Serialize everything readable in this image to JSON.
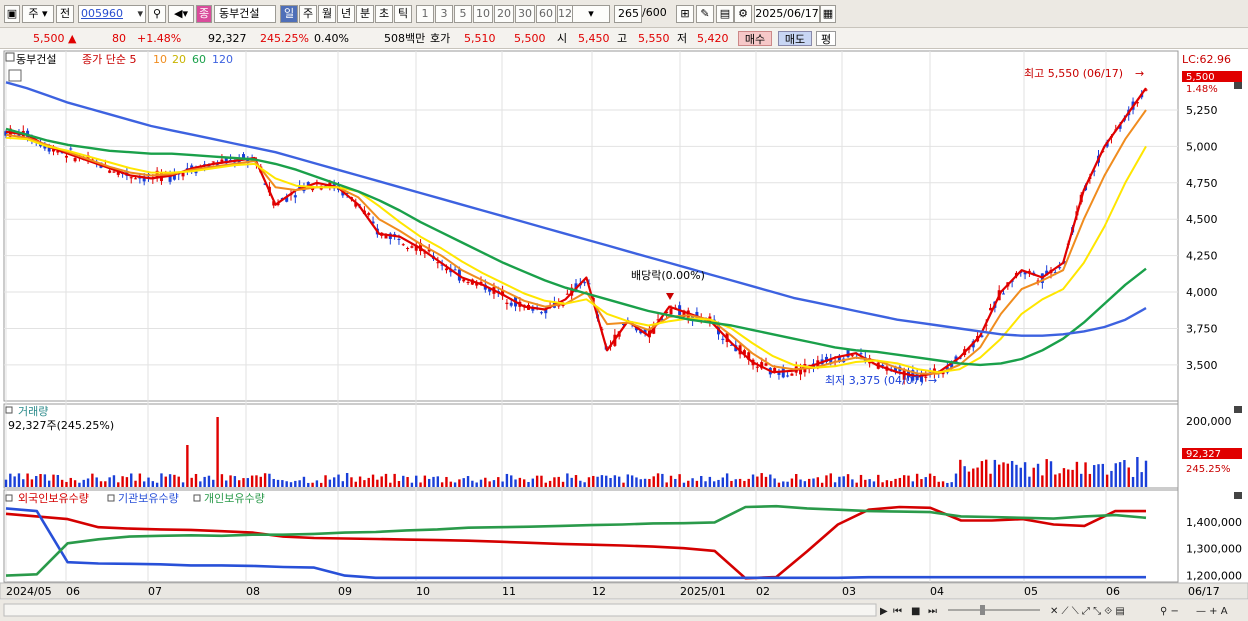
{
  "toolbar": {
    "market": "주",
    "prev_label": "전",
    "code": "005960",
    "stock_name": "동부건설",
    "stock_badge": "종",
    "periods": [
      "일",
      "주",
      "월",
      "년",
      "분",
      "초",
      "틱"
    ],
    "active_period": "일",
    "intervals": [
      "1",
      "3",
      "5",
      "10",
      "20",
      "30",
      "60",
      "120"
    ],
    "count": "265",
    "count_total": "/600",
    "date": "2025/06/17"
  },
  "quote": {
    "price": "5,500",
    "change": "80",
    "change_pct": "+1.48%",
    "volume": "92,327",
    "volume_ratio": "245.25%",
    "turnover": "0.40%",
    "amount": "508백만",
    "bid_label": "호가",
    "bid": "5,510",
    "ask": "5,500",
    "open_label": "시",
    "open": "5,450",
    "high_label": "고",
    "high": "5,550",
    "low_label": "저",
    "low": "5,420",
    "buy_label": "매수",
    "sell_label": "매도",
    "avg_label": "평"
  },
  "price_panel": {
    "stock_name": "동부건설",
    "ma_title": "종가 단순 5",
    "ma_periods": [
      "10",
      "20",
      "60",
      "120"
    ],
    "high_annotation": "최고 5,550 (06/17)",
    "low_annotation": "최저 3,375 (04/07)",
    "dividend_annotation": "배당락(0.00%)",
    "right_top": "LC:62.96",
    "price_badge": "5,500",
    "pct_badge": "1.48%"
  },
  "volume_panel": {
    "title": "거래량",
    "value_text": "92,327주(245.25%)",
    "badge": "92,327",
    "badge_pct": "245.25%"
  },
  "holdings_panel": {
    "legend": [
      "외국인보유수량",
      "기관보유수량",
      "개인보유수량"
    ]
  },
  "colors": {
    "up": "#e00000",
    "down": "#1a3fd8",
    "ma5": "#e00000",
    "ma10": "#f08c1e",
    "ma20": "#ffe600",
    "ma60": "#1aa04a",
    "ma120": "#3d62e0"
  },
  "chart_data": {
    "type": "line",
    "price_axis": [
      "5,250",
      "5,000",
      "4,750",
      "4,500",
      "4,250",
      "4,000",
      "3,750",
      "3,500"
    ],
    "price_ylim": [
      3300,
      5600
    ],
    "volume_axis": [
      "200,000"
    ],
    "holdings_axis": [
      "1,400,000",
      "1,300,000",
      "1,200,000"
    ],
    "x_labels": [
      "2024/05",
      "06",
      "07",
      "08",
      "09",
      "10",
      "11",
      "12",
      "2025/01",
      "02",
      "03",
      "04",
      "05",
      "06",
      "06/17"
    ],
    "series": [
      {
        "name": "5",
        "values": [
          5100,
          5080,
          5000,
          4950,
          4900,
          4850,
          4800,
          4780,
          4800,
          4850,
          4880,
          4900,
          4920,
          4600,
          4700,
          4750,
          4720,
          4600,
          4400,
          4380,
          4300,
          4200,
          4100,
          4050,
          3980,
          3900,
          3880,
          3950,
          4100,
          3600,
          3800,
          3700,
          3900,
          3850,
          3800,
          3650,
          3520,
          3450,
          3460,
          3500,
          3550,
          3580,
          3500,
          3450,
          3420,
          3450,
          3550,
          3700,
          4000,
          4150,
          4100,
          4200,
          4700,
          5000,
          5200,
          5400
        ]
      },
      {
        "name": "10",
        "values": [
          5080,
          5060,
          5010,
          4960,
          4910,
          4860,
          4820,
          4800,
          4810,
          4840,
          4860,
          4880,
          4900,
          4720,
          4700,
          4720,
          4720,
          4650,
          4500,
          4420,
          4330,
          4250,
          4150,
          4080,
          4010,
          3940,
          3900,
          3920,
          4000,
          3780,
          3790,
          3740,
          3830,
          3840,
          3810,
          3700,
          3580,
          3490,
          3470,
          3480,
          3520,
          3550,
          3530,
          3480,
          3440,
          3440,
          3500,
          3620,
          3850,
          4020,
          4080,
          4150,
          4500,
          4800,
          5050,
          5250
        ]
      },
      {
        "name": "20",
        "values": [
          5060,
          5050,
          5000,
          4970,
          4930,
          4890,
          4850,
          4820,
          4820,
          4830,
          4850,
          4870,
          4880,
          4780,
          4730,
          4720,
          4720,
          4690,
          4590,
          4480,
          4380,
          4300,
          4210,
          4130,
          4060,
          3990,
          3940,
          3920,
          3950,
          3850,
          3800,
          3770,
          3800,
          3820,
          3810,
          3750,
          3650,
          3560,
          3500,
          3480,
          3490,
          3520,
          3530,
          3510,
          3470,
          3450,
          3470,
          3550,
          3680,
          3850,
          3950,
          4020,
          4200,
          4450,
          4750,
          5000
        ]
      },
      {
        "name": "60",
        "values": [
          5120,
          5080,
          5040,
          5010,
          4990,
          4970,
          4960,
          4950,
          4950,
          4940,
          4930,
          4920,
          4910,
          4880,
          4840,
          4790,
          4740,
          4690,
          4630,
          4560,
          4480,
          4410,
          4340,
          4270,
          4200,
          4140,
          4080,
          4030,
          3990,
          3950,
          3910,
          3870,
          3840,
          3810,
          3790,
          3770,
          3740,
          3710,
          3680,
          3650,
          3620,
          3600,
          3590,
          3570,
          3550,
          3530,
          3510,
          3500,
          3510,
          3540,
          3600,
          3680,
          3790,
          3920,
          4050,
          4160
        ]
      },
      {
        "name": "120",
        "values": [
          5440,
          5400,
          5350,
          5300,
          5260,
          5220,
          5180,
          5140,
          5110,
          5080,
          5050,
          5020,
          4990,
          4960,
          4920,
          4880,
          4840,
          4800,
          4760,
          4720,
          4680,
          4640,
          4600,
          4560,
          4520,
          4480,
          4440,
          4400,
          4360,
          4320,
          4280,
          4240,
          4200,
          4160,
          4120,
          4080,
          4040,
          4000,
          3960,
          3930,
          3900,
          3870,
          3840,
          3810,
          3790,
          3770,
          3750,
          3730,
          3710,
          3700,
          3700,
          3710,
          3730,
          3760,
          3810,
          3890
        ]
      }
    ],
    "holdings": [
      {
        "name": "외국인보유수량",
        "color": "#d40000",
        "values": [
          1430000,
          1420000,
          1410000,
          1380000,
          1375000,
          1372000,
          1370000,
          1365000,
          1360000,
          1345000,
          1340000,
          1338000,
          1336000,
          1334000,
          1332000,
          1330000,
          1326000,
          1322000,
          1318000,
          1315000,
          1312000,
          1308000,
          1302000,
          1292000,
          1190000,
          1195000,
          1290000,
          1390000,
          1445000,
          1455000,
          1452000,
          1405000,
          1405000,
          1410000,
          1390000,
          1385000,
          1440000,
          1440000
        ]
      },
      {
        "name": "기관보유수량",
        "color": "#2850d8",
        "values": [
          1450000,
          1440000,
          1250000,
          1245000,
          1244000,
          1242000,
          1238000,
          1238000,
          1236000,
          1232000,
          1230000,
          1200000,
          1192000,
          1192000,
          1192000,
          1192000,
          1192000,
          1192000,
          1192000,
          1192000,
          1192000,
          1192000,
          1192000,
          1192000,
          1192000,
          1192000,
          1192000,
          1192000,
          1194000,
          1194000,
          1194000,
          1194000,
          1194000,
          1194000,
          1194000,
          1194000,
          1194000,
          1194000
        ]
      },
      {
        "name": "개인보유수량",
        "color": "#2a9a4a",
        "values": [
          1200000,
          1205000,
          1320000,
          1335000,
          1345000,
          1348000,
          1350000,
          1348000,
          1352000,
          1352000,
          1355000,
          1360000,
          1362000,
          1368000,
          1372000,
          1378000,
          1380000,
          1382000,
          1385000,
          1388000,
          1390000,
          1394000,
          1395000,
          1398000,
          1455000,
          1458000,
          1450000,
          1445000,
          1440000,
          1438000,
          1436000,
          1420000,
          1418000,
          1415000,
          1412000,
          1420000,
          1425000,
          1415000
        ]
      }
    ]
  }
}
